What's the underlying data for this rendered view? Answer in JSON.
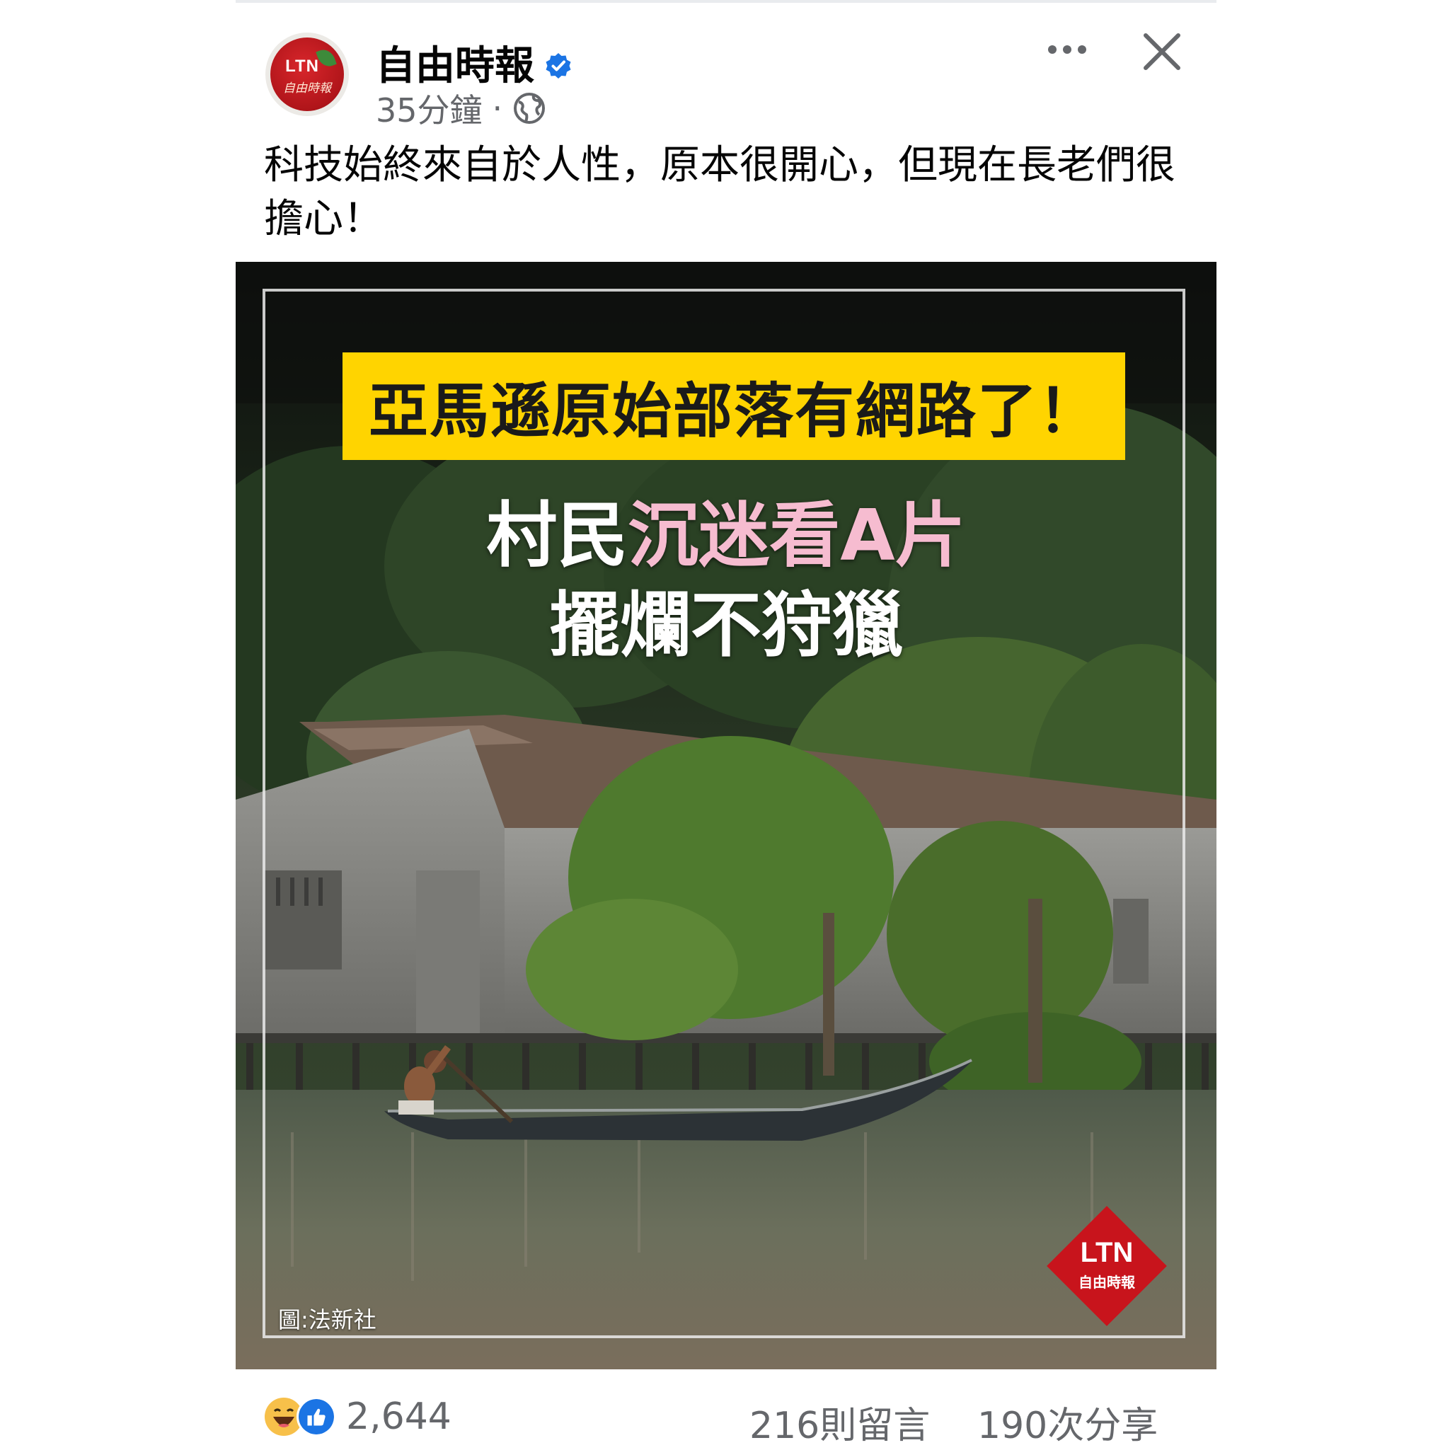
{
  "post": {
    "page_name": "自由時報",
    "avatar": {
      "logo_text": "LTN",
      "logo_sub": "自由時報"
    },
    "time": "35分鐘",
    "separator": "·",
    "caption": "科技始終來自於人性，原本很開心，但現在長老們很擔心！",
    "image": {
      "headline": "亞馬遜原始部落有網路了！",
      "subline_1_plain": "村民",
      "subline_1_highlight": "沉迷看A片",
      "subline_2": "擺爛不狩獵",
      "credit": "圖:法新社",
      "watermark_text": "LTN",
      "watermark_sub": "自由時報"
    },
    "stats": {
      "reactions": "2,644",
      "comments": "216則留言",
      "shares": "190次分享"
    }
  },
  "icons": {
    "verified": "verified-badge-icon",
    "audience": "globe-icon",
    "more": "more-options-icon",
    "close": "close-icon",
    "reaction_1": "haha-icon",
    "reaction_2": "like-icon"
  },
  "colors": {
    "headline_bg": "#ffd400",
    "highlight_text": "#f6bcd0",
    "verified_blue": "#1b74e4",
    "secondary_text": "#65676b",
    "brand_red": "#c8141c"
  }
}
